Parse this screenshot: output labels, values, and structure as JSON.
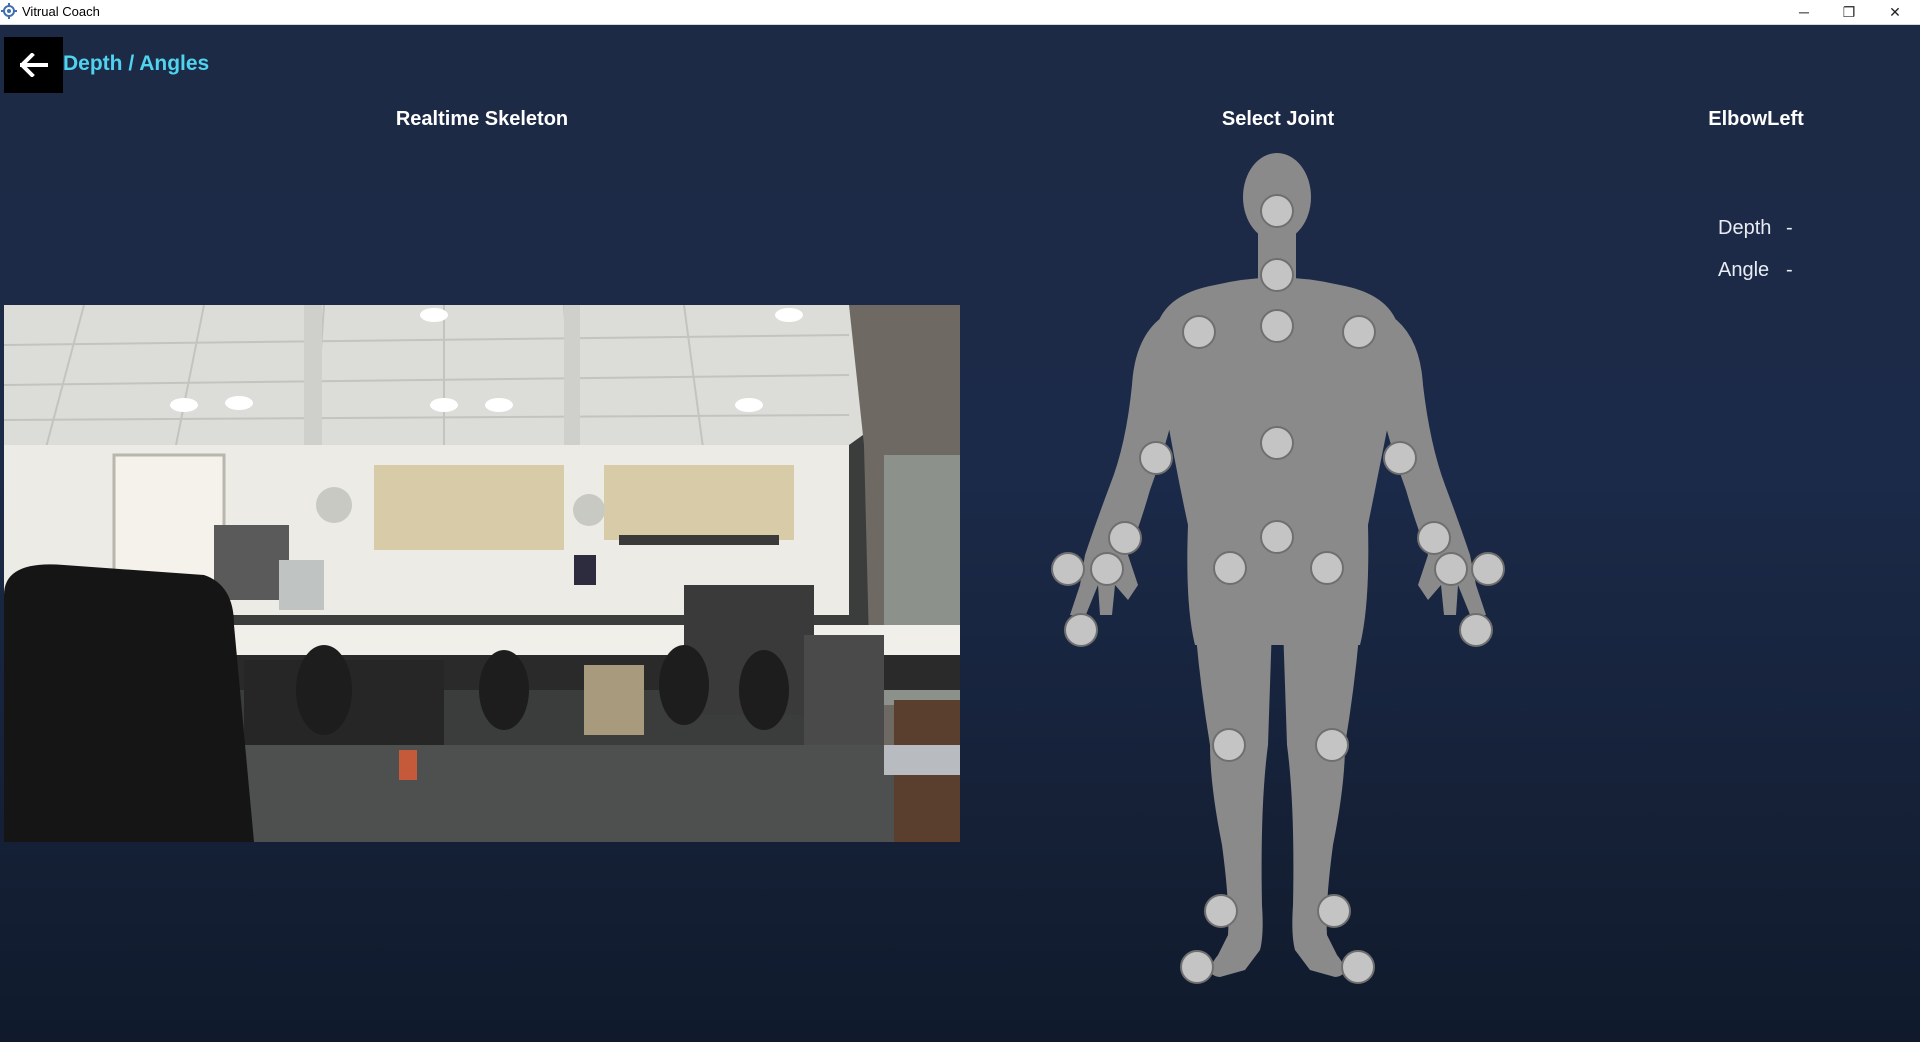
{
  "window": {
    "title": "Vitrual Coach",
    "icon": "gear-app-icon",
    "controls": {
      "minimize": "─",
      "maximize": "❐",
      "close": "✕"
    }
  },
  "header": {
    "back_icon": "arrow-left-icon",
    "title": "Depth / Angles"
  },
  "columns": {
    "realtime": "Realtime Skeleton",
    "select": "Select Joint",
    "selected_joint": "ElbowLeft"
  },
  "stats": {
    "depth_label": "Depth",
    "depth_value": "-",
    "angle_label": "Angle",
    "angle_value": "-"
  },
  "colors": {
    "accent": "#4fd3ee",
    "body": "#8a8a8a",
    "joint_fill": "#c4c4c4",
    "joint_stroke": "#6f6f6f"
  },
  "joints": [
    "head",
    "neck",
    "spine-shoulder",
    "shoulder-right",
    "shoulder-left",
    "spine-mid",
    "spine-base",
    "hip-right",
    "hip-left",
    "elbow-right",
    "elbow-left",
    "wrist-right",
    "wrist-left",
    "hand-right",
    "hand-left",
    "thumb-right",
    "thumb-left",
    "handtip-right",
    "handtip-left",
    "knee-right",
    "knee-left",
    "ankle-right",
    "ankle-left",
    "foot-right",
    "foot-left"
  ]
}
